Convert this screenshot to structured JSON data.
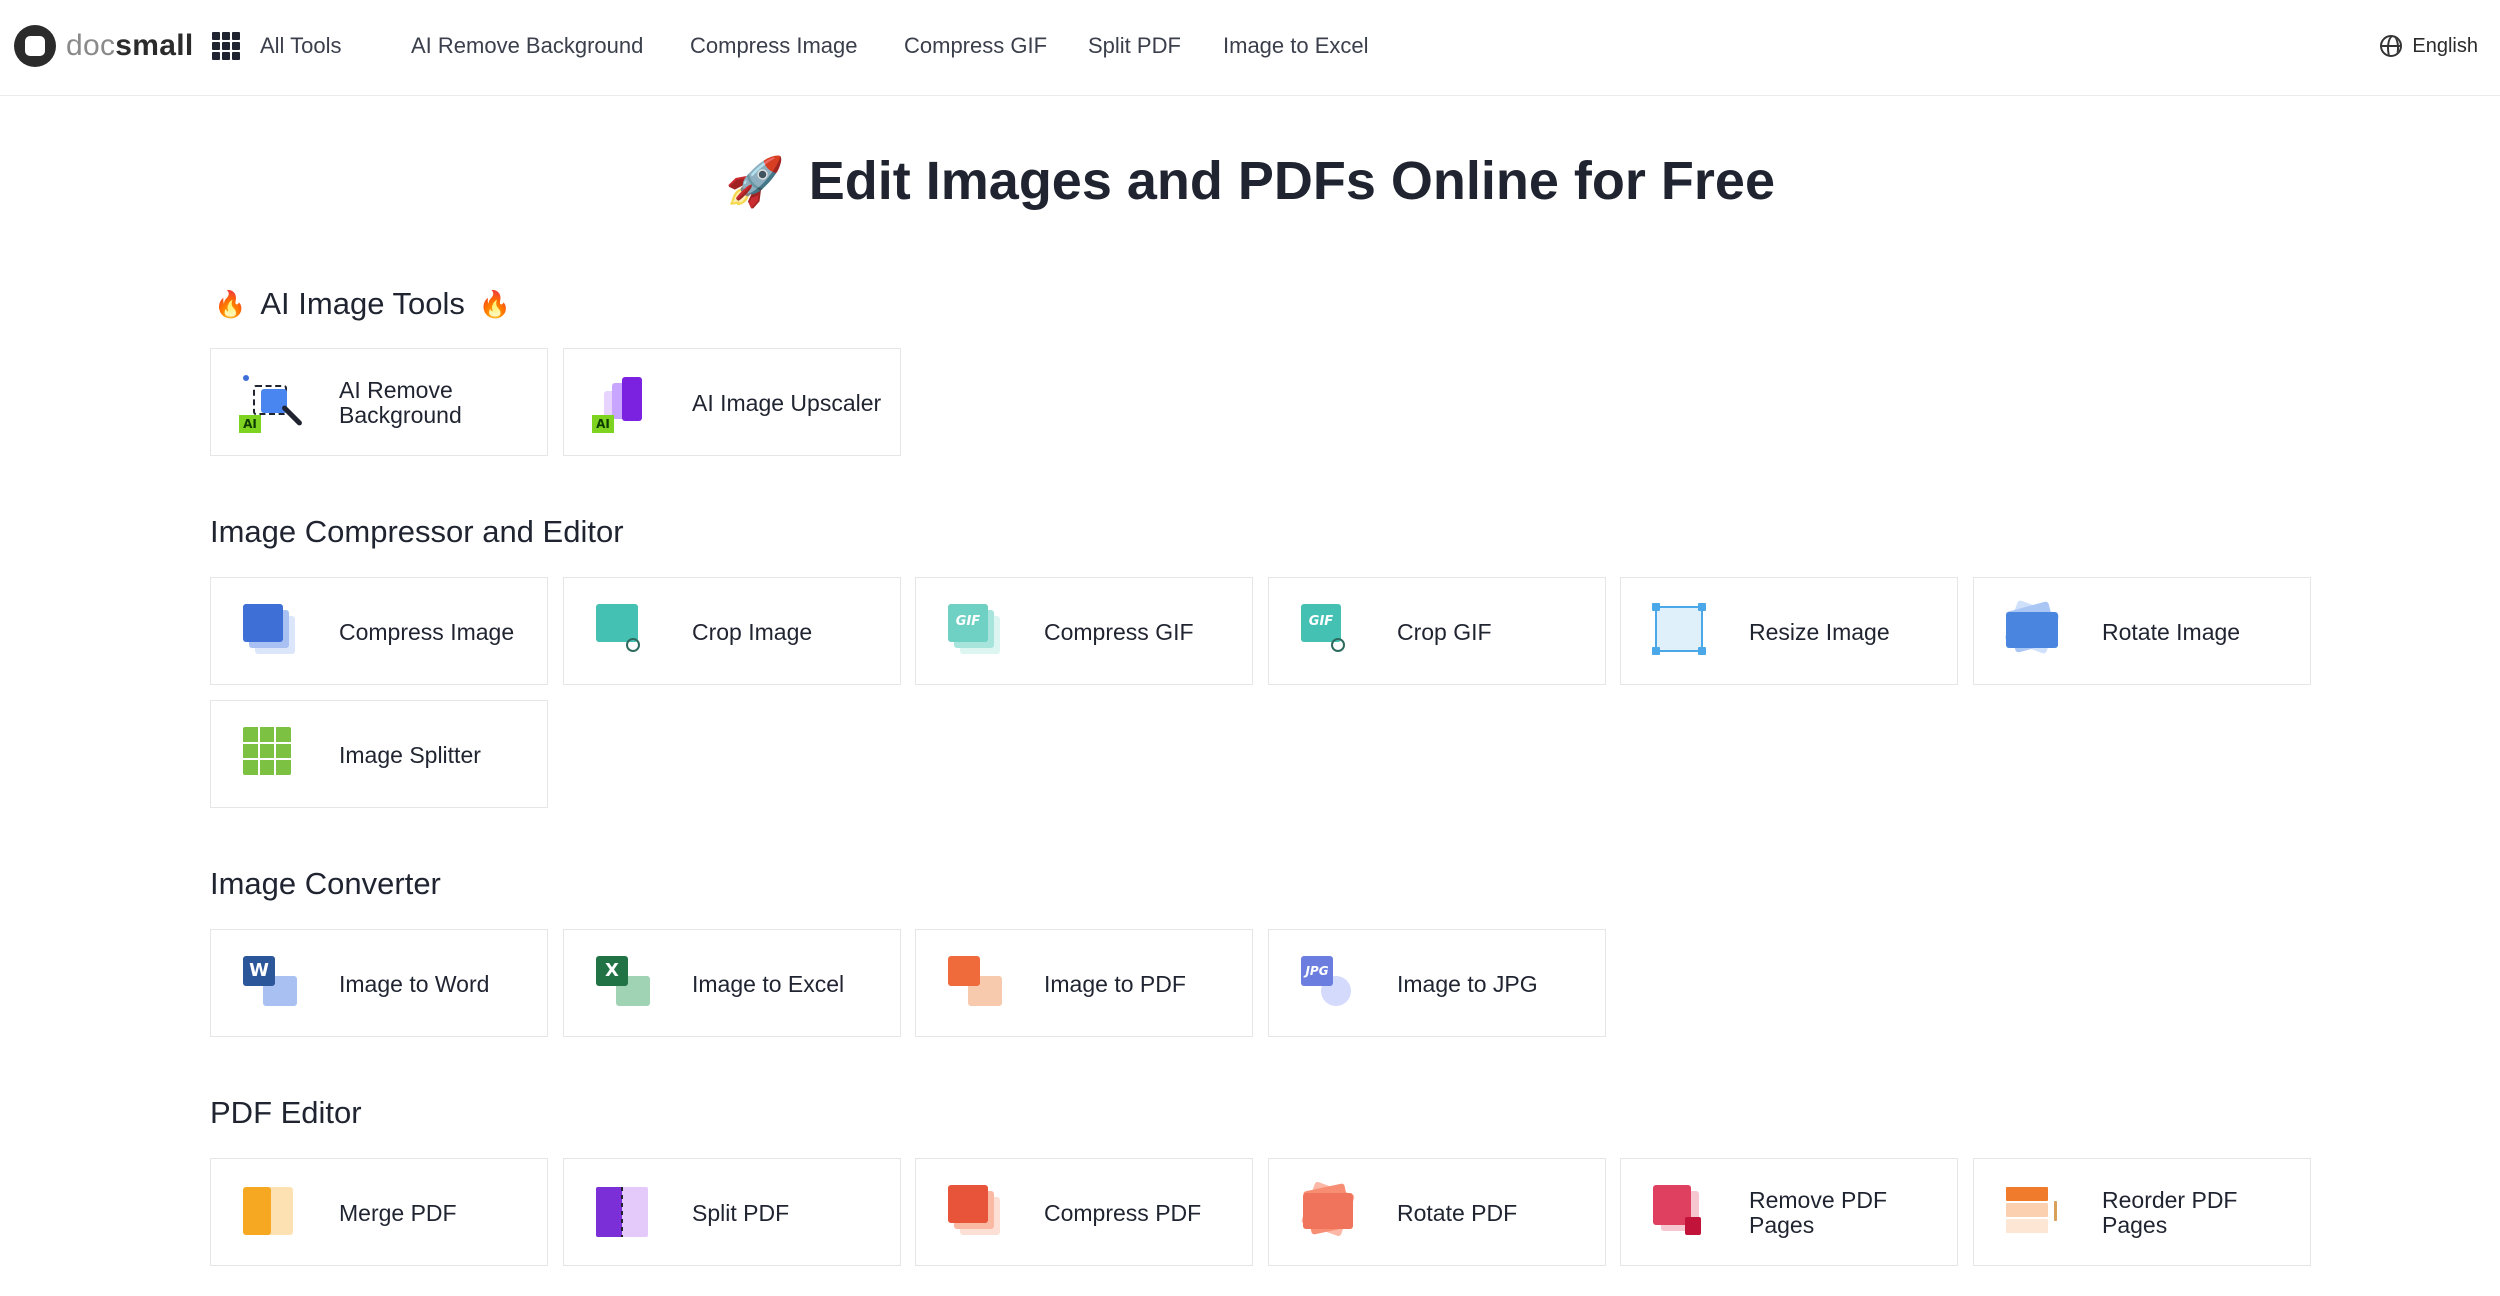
{
  "header": {
    "logo": {
      "doc": "doc",
      "small": "small"
    },
    "all_tools": "All Tools",
    "nav": [
      "AI Remove Background",
      "Compress Image",
      "Compress GIF",
      "Split PDF",
      "Image to Excel"
    ],
    "language": "English"
  },
  "hero": {
    "emoji": "🚀",
    "title": "Edit Images and PDFs Online for Free"
  },
  "sections": {
    "ai": {
      "title": "AI Image Tools",
      "emoji": "🔥",
      "tools": [
        "AI Remove Background",
        "AI Image Upscaler"
      ]
    },
    "compressor": {
      "title": "Image Compressor and Editor",
      "tools": [
        "Compress Image",
        "Crop Image",
        "Compress GIF",
        "Crop GIF",
        "Resize Image",
        "Rotate Image",
        "Image Splitter"
      ]
    },
    "converter": {
      "title": "Image Converter",
      "tools": [
        "Image to Word",
        "Image to Excel",
        "Image to PDF",
        "Image to JPG"
      ]
    },
    "pdf": {
      "title": "PDF Editor",
      "tools": [
        "Merge PDF",
        "Split PDF",
        "Compress PDF",
        "Rotate PDF",
        "Remove PDF Pages",
        "Reorder PDF Pages"
      ]
    }
  },
  "icon_text": {
    "ai": "AI",
    "gif": "GIF",
    "w": "W",
    "x": "X",
    "jpg": "JPG"
  },
  "colors": {
    "blue": "#3d6fd6",
    "teal": "#45c1b4",
    "green": "#7cc142",
    "word": "#2b579a",
    "excel": "#217346",
    "pdf": "#f06b3c",
    "purple": "#7b2fd6"
  }
}
